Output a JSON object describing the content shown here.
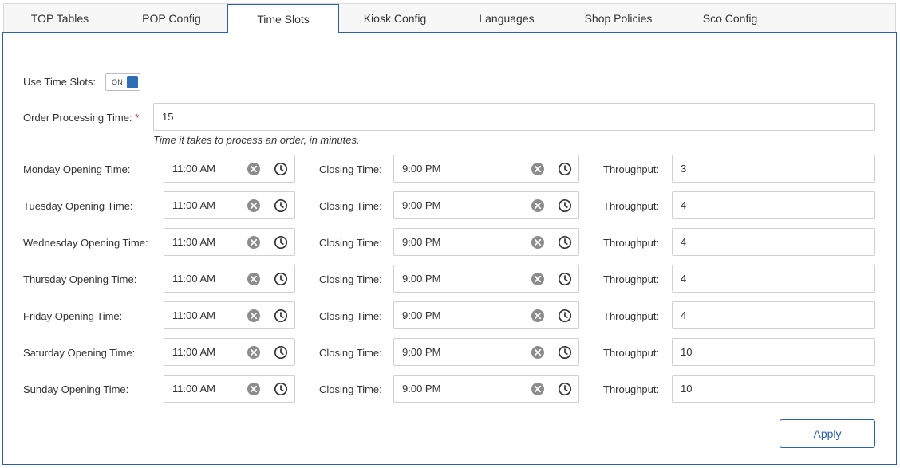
{
  "tabs": [
    {
      "label": "TOP Tables"
    },
    {
      "label": "POP Config"
    },
    {
      "label": "Time Slots"
    },
    {
      "label": "Kiosk Config"
    },
    {
      "label": "Languages"
    },
    {
      "label": "Shop Policies"
    },
    {
      "label": "Sco Config"
    }
  ],
  "active_tab": "Time Slots",
  "use_time_slots": {
    "label": "Use Time Slots:",
    "state": "ON"
  },
  "order_processing": {
    "label": "Order Processing Time:",
    "required_mark": "*",
    "value": "15",
    "hint": "Time it takes to process an order, in minutes."
  },
  "closing_label": "Closing Time:",
  "throughput_label": "Throughput:",
  "days": [
    {
      "label": "Monday Opening Time:",
      "open": "11:00 AM",
      "close": "9:00 PM",
      "throughput": "3"
    },
    {
      "label": "Tuesday Opening Time:",
      "open": "11:00 AM",
      "close": "9:00 PM",
      "throughput": "4"
    },
    {
      "label": "Wednesday Opening Time:",
      "open": "11:00 AM",
      "close": "9:00 PM",
      "throughput": "4"
    },
    {
      "label": "Thursday Opening Time:",
      "open": "11:00 AM",
      "close": "9:00 PM",
      "throughput": "4"
    },
    {
      "label": "Friday Opening Time:",
      "open": "11:00 AM",
      "close": "9:00 PM",
      "throughput": "4"
    },
    {
      "label": "Saturday Opening Time:",
      "open": "11:00 AM",
      "close": "9:00 PM",
      "throughput": "10"
    },
    {
      "label": "Sunday Opening Time:",
      "open": "11:00 AM",
      "close": "9:00 PM",
      "throughput": "10"
    }
  ],
  "apply_label": "Apply",
  "colors": {
    "accent": "#2d5fa8",
    "toggle_on": "#2f6db5",
    "required": "#c62828"
  }
}
